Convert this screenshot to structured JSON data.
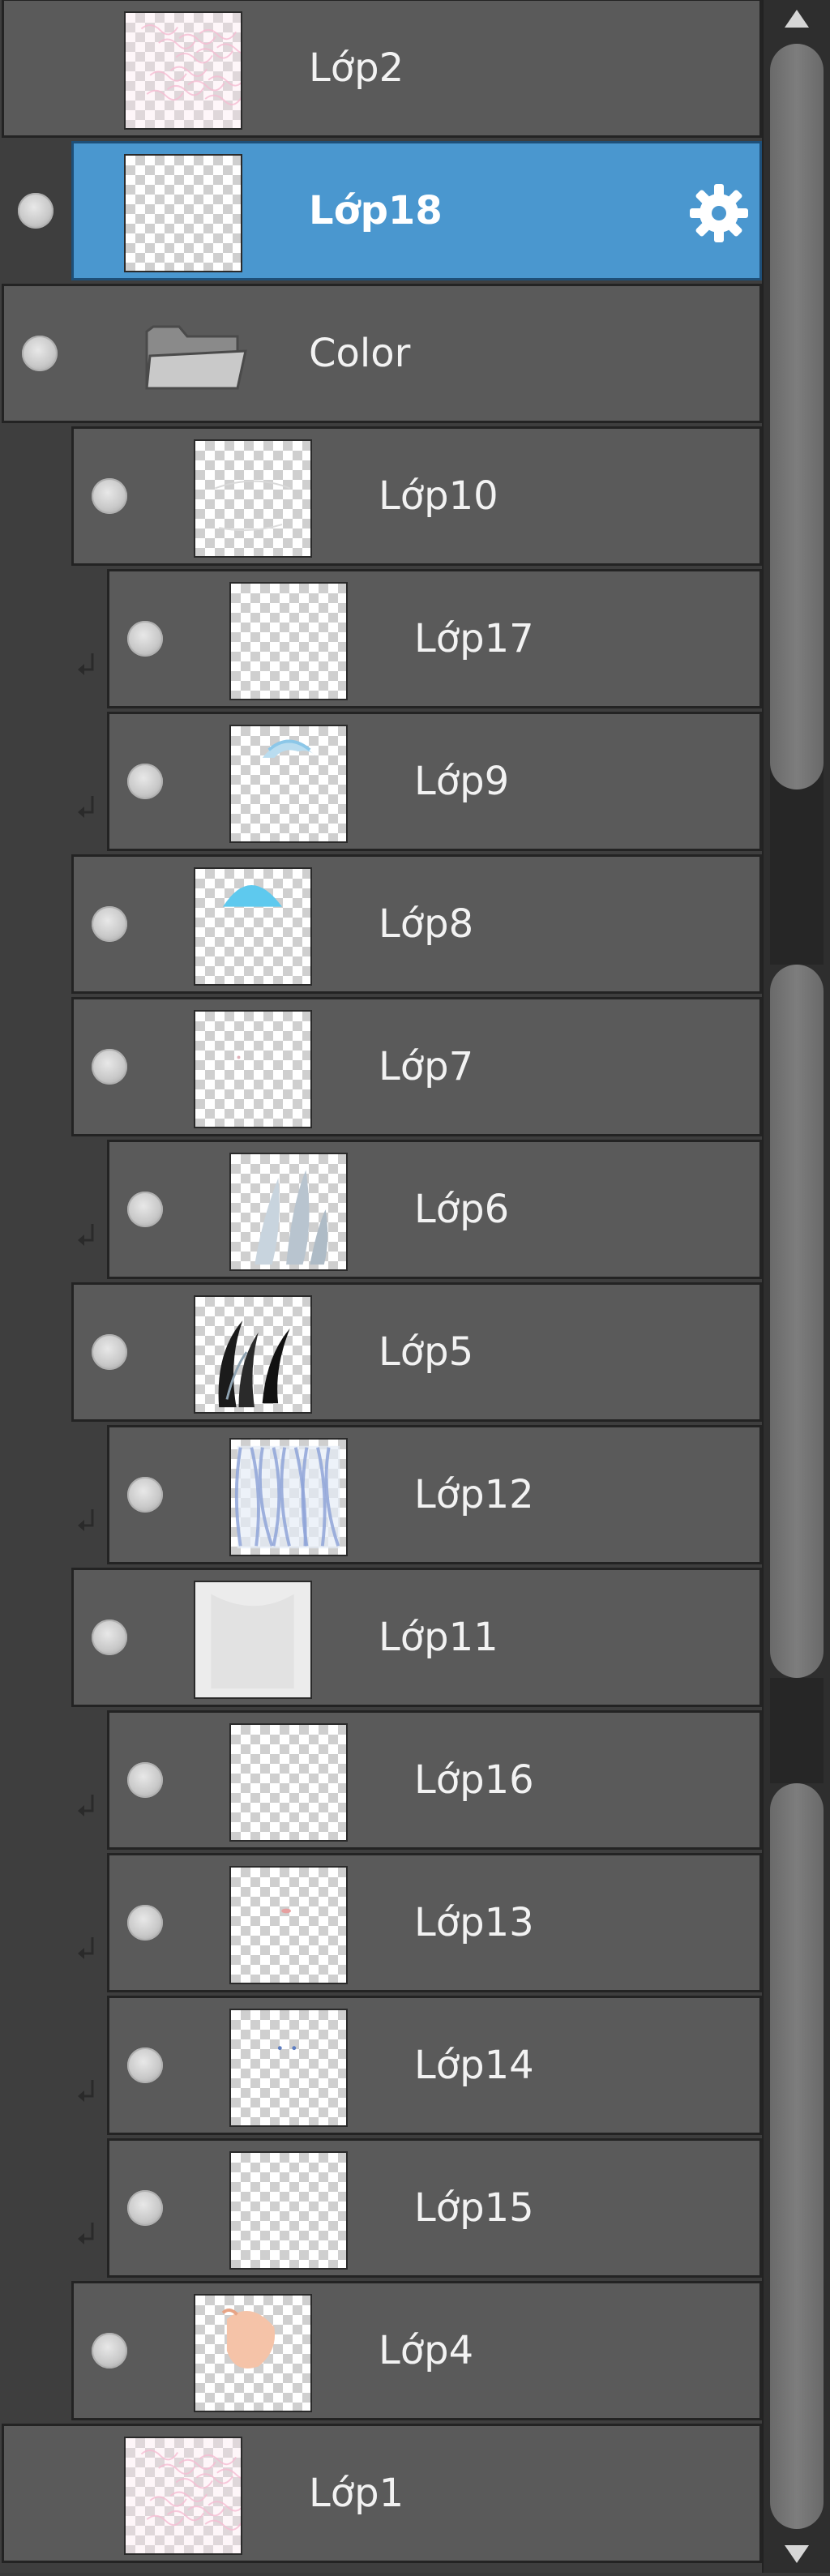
{
  "layers": [
    {
      "name": "Lớp2",
      "indent": 0,
      "visible": false,
      "clipped": false,
      "selected": false,
      "type": "layer",
      "thumb": "sketch-pink"
    },
    {
      "name": "Lớp18",
      "indent": 0,
      "visible": true,
      "clipped": false,
      "selected": true,
      "type": "layer",
      "thumb": "empty"
    },
    {
      "name": "Color",
      "indent": 0,
      "visible": true,
      "clipped": false,
      "selected": false,
      "type": "folder",
      "thumb": "folder"
    },
    {
      "name": "Lớp10",
      "indent": 1,
      "visible": true,
      "clipped": false,
      "selected": false,
      "type": "layer",
      "thumb": "faint-lines"
    },
    {
      "name": "Lớp17",
      "indent": 2,
      "visible": true,
      "clipped": true,
      "selected": false,
      "type": "layer",
      "thumb": "empty"
    },
    {
      "name": "Lớp9",
      "indent": 2,
      "visible": true,
      "clipped": true,
      "selected": false,
      "type": "layer",
      "thumb": "blue-cap"
    },
    {
      "name": "Lớp8",
      "indent": 1,
      "visible": true,
      "clipped": false,
      "selected": false,
      "type": "layer",
      "thumb": "cyan-dome"
    },
    {
      "name": "Lớp7",
      "indent": 1,
      "visible": true,
      "clipped": false,
      "selected": false,
      "type": "layer",
      "thumb": "dot"
    },
    {
      "name": "Lớp6",
      "indent": 2,
      "visible": true,
      "clipped": true,
      "selected": false,
      "type": "layer",
      "thumb": "grey-shade"
    },
    {
      "name": "Lớp5",
      "indent": 1,
      "visible": true,
      "clipped": false,
      "selected": false,
      "type": "layer",
      "thumb": "black-strands"
    },
    {
      "name": "Lớp12",
      "indent": 2,
      "visible": true,
      "clipped": true,
      "selected": false,
      "type": "layer",
      "thumb": "blue-hair"
    },
    {
      "name": "Lớp11",
      "indent": 1,
      "visible": true,
      "clipped": false,
      "selected": false,
      "type": "layer",
      "thumb": "white-base"
    },
    {
      "name": "Lớp16",
      "indent": 2,
      "visible": true,
      "clipped": true,
      "selected": false,
      "type": "layer",
      "thumb": "empty"
    },
    {
      "name": "Lớp13",
      "indent": 2,
      "visible": true,
      "clipped": true,
      "selected": false,
      "type": "layer",
      "thumb": "red-dot"
    },
    {
      "name": "Lớp14",
      "indent": 2,
      "visible": true,
      "clipped": true,
      "selected": false,
      "type": "layer",
      "thumb": "blue-dots"
    },
    {
      "name": "Lớp15",
      "indent": 2,
      "visible": true,
      "clipped": true,
      "selected": false,
      "type": "layer",
      "thumb": "empty"
    },
    {
      "name": "Lớp4",
      "indent": 1,
      "visible": true,
      "clipped": false,
      "selected": false,
      "type": "layer",
      "thumb": "skin"
    },
    {
      "name": "Lớp1",
      "indent": 0,
      "visible": false,
      "clipped": false,
      "selected": false,
      "type": "layer",
      "thumb": "sketch-pink"
    }
  ],
  "colors": {
    "row_bg": "#5a5a5a",
    "selected_bg": "#4a97cf",
    "panel_bg": "#3e3e3e",
    "text": "#f2f2f2"
  },
  "icons": {
    "visibility": "eye-dot-icon",
    "clipping": "clip-arrow-icon",
    "folder": "folder-icon",
    "settings": "gear-icon",
    "scroll_up": "triangle-up-icon",
    "scroll_down": "triangle-down-icon"
  }
}
